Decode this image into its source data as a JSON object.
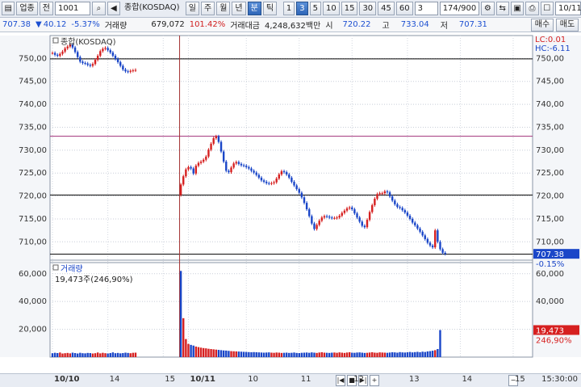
{
  "toolbar": {
    "category": "업종",
    "market": "전",
    "code": "1001",
    "name": "종합(KOSDAQ)",
    "periods": [
      "일",
      "주",
      "월",
      "년",
      "분",
      "틱"
    ],
    "active_period": "분",
    "intervals": [
      "1",
      "3",
      "5",
      "10",
      "15",
      "30",
      "45",
      "60"
    ],
    "active_interval": "3",
    "interval_select": "3",
    "count": "174/900",
    "date": "10/11"
  },
  "info": {
    "price": "707.38",
    "change": "40.12",
    "change_pct": "-5.37%",
    "volume_label": "거래량",
    "volume": "679,072",
    "volume_ratio": "101.42%",
    "amount_label": "거래대금",
    "amount": "4,248,632백만",
    "open_label": "시",
    "open": "720.22",
    "high_label": "고",
    "high": "733.04",
    "low_label": "저",
    "low": "707.31",
    "buy": "매수",
    "sell": "매도"
  },
  "chart_data": {
    "type": "candlestick",
    "price_legend": "종합(KOSDAQ)",
    "lc": "LC:0.01",
    "hc": "HC:-6.11",
    "price_ticks": [
      750,
      745,
      740,
      735,
      730,
      725,
      720,
      715,
      710
    ],
    "price_tick_labels": [
      "750,00",
      "745,00",
      "740,00",
      "735,00",
      "730,00",
      "725,00",
      "720,00",
      "715,00",
      "710,00"
    ],
    "price_range": [
      706,
      755
    ],
    "current_price": "707.38",
    "current_pct": "-0.15%",
    "hlines": [
      {
        "value": 749.9,
        "color": "#000000"
      },
      {
        "value": 733.04,
        "color": "#a0307a"
      },
      {
        "value": 720.22,
        "color": "#000000"
      },
      {
        "value": 707.31,
        "color": "#000000"
      }
    ],
    "volume_legend": "거래량",
    "volume_info": "19,473주(246,90%)",
    "volume_ticks": [
      60000,
      40000,
      20000
    ],
    "volume_tick_labels": [
      "60,000",
      "40,000",
      "20,000"
    ],
    "volume_range": [
      0,
      68000
    ],
    "current_volume": "19,473",
    "current_volume_pct": "246,90%",
    "x_labels": [
      {
        "index": 0,
        "text": "10/10"
      },
      {
        "index": 22,
        "text": "14"
      },
      {
        "index": 44,
        "text": "15"
      },
      {
        "index": 54,
        "text": "10/11"
      },
      {
        "index": 77,
        "text": "10"
      },
      {
        "index": 98,
        "text": "11"
      },
      {
        "index": 119,
        "text": "12"
      },
      {
        "index": 141,
        "text": "13"
      },
      {
        "index": 162,
        "text": "14"
      },
      {
        "index": 183,
        "text": "15"
      }
    ],
    "day_break_index": 51,
    "closes": [
      751.2,
      750.8,
      750.6,
      751.0,
      751.5,
      752.2,
      752.6,
      753.0,
      752.4,
      751.4,
      750.3,
      749.3,
      749.0,
      748.9,
      748.6,
      748.4,
      748.8,
      749.7,
      750.6,
      751.6,
      752.1,
      752.3,
      751.8,
      751.3,
      750.6,
      749.9,
      749.2,
      748.4,
      747.6,
      747.2,
      747.1,
      747.3,
      747.4,
      747.5,
      722.5,
      724.3,
      725.8,
      726.3,
      726.0,
      724.9,
      726.6,
      727.2,
      727.5,
      727.9,
      728.6,
      730.1,
      731.4,
      732.6,
      733.0,
      731.8,
      729.7,
      727.5,
      725.5,
      725.2,
      726.2,
      727.1,
      727.4,
      727.0,
      726.7,
      726.6,
      726.3,
      726.0,
      725.5,
      725.1,
      724.6,
      724.0,
      723.4,
      723.1,
      722.8,
      722.7,
      722.8,
      723.0,
      723.8,
      724.7,
      725.4,
      725.2,
      724.7,
      724.0,
      723.1,
      722.3,
      721.5,
      720.7,
      719.7,
      718.5,
      717.1,
      715.6,
      714.0,
      712.8,
      713.7,
      714.6,
      715.3,
      715.6,
      715.5,
      715.3,
      715.2,
      715.2,
      715.3,
      715.7,
      716.3,
      716.8,
      717.3,
      717.5,
      717.1,
      716.2,
      715.3,
      714.4,
      713.5,
      713.2,
      714.8,
      716.5,
      718.0,
      719.4,
      720.4,
      720.6,
      720.6,
      721.0,
      720.8,
      719.9,
      719.0,
      718.2,
      717.6,
      717.4,
      716.9,
      716.4,
      715.7,
      715.0,
      714.2,
      713.6,
      712.9,
      712.2,
      711.4,
      710.6,
      709.8,
      709.2,
      708.8,
      712.5,
      710.0,
      708.4,
      707.6,
      707.38
    ],
    "volumes": [
      2800,
      3100,
      2900,
      3300,
      2600,
      2800,
      3000,
      2700,
      3200,
      2900,
      2600,
      3100,
      2800,
      2700,
      3000,
      2900,
      2600,
      2800,
      3300,
      2700,
      3100,
      2800,
      2600,
      2900,
      3400,
      2800,
      3000,
      2700,
      2900,
      3200,
      3000,
      2800,
      3100,
      3200,
      62000,
      28000,
      13000,
      9500,
      8800,
      8300,
      7600,
      7200,
      6800,
      6500,
      6300,
      6000,
      5800,
      5600,
      5400,
      5200,
      5000,
      4800,
      4700,
      4500,
      4300,
      4200,
      4100,
      4000,
      3900,
      3800,
      3700,
      3600,
      3500,
      3600,
      3500,
      3400,
      3300,
      3200,
      3300,
      3400,
      3200,
      3100,
      3300,
      3200,
      3000,
      3100,
      3200,
      3000,
      3100,
      3300,
      3000,
      2900,
      3100,
      3200,
      3300,
      3100,
      3400,
      3200,
      3000,
      3300,
      3500,
      3200,
      3100,
      3000,
      3200,
      3300,
      3100,
      3400,
      3200,
      3000,
      3300,
      3500,
      3200,
      3100,
      3300,
      3400,
      3200,
      3000,
      3100,
      3300,
      3500,
      3200,
      3100,
      3400,
      3300,
      3200,
      3100,
      3300,
      3500,
      3400,
      3200,
      3600,
      3400,
      3300,
      3500,
      3700,
      3400,
      3600,
      3800,
      3500,
      3900,
      3700,
      4100,
      4300,
      4600,
      5000,
      5800,
      19473
    ]
  },
  "bottom": {
    "time": "15:30:00"
  }
}
